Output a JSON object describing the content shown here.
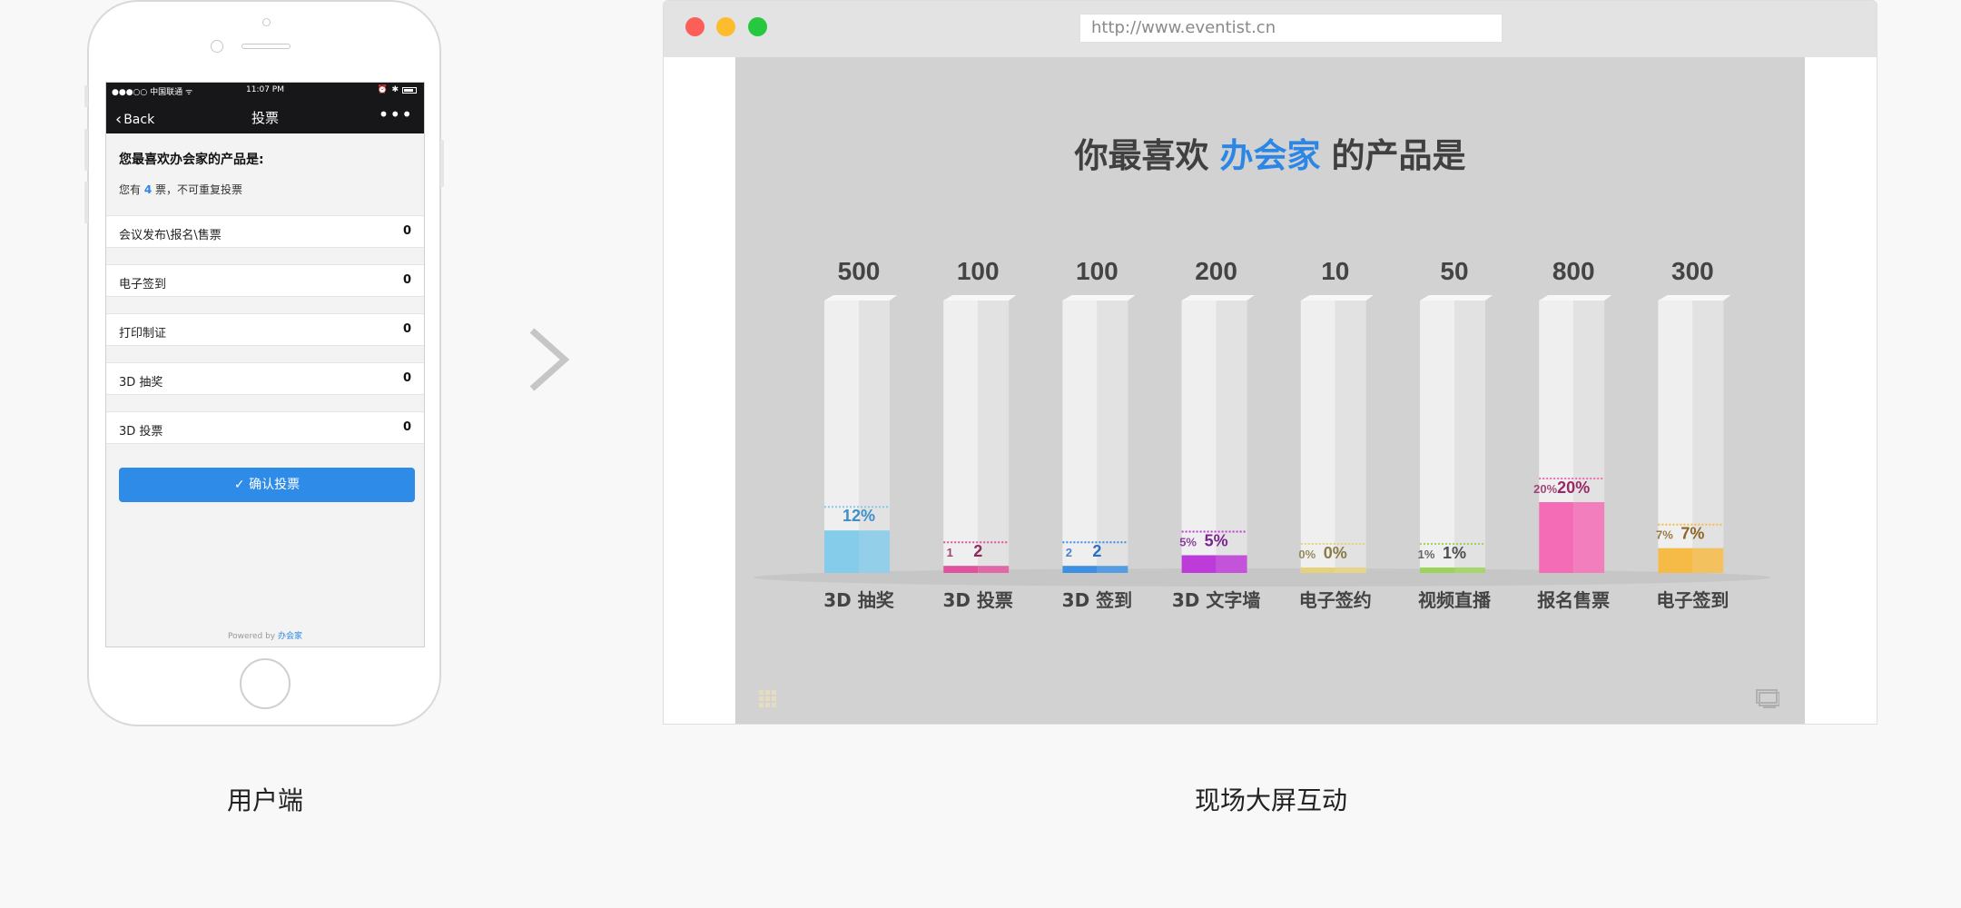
{
  "phone": {
    "status": {
      "carrier": "●●●○○ 中国联通 ᯤ",
      "time": "11:07 PM"
    },
    "nav": {
      "back": "Back",
      "title": "投票",
      "more": "•••"
    },
    "question": "您最喜欢办会家的产品是:",
    "note_prefix": "您有",
    "votes": "4",
    "note_suffix": "票，不可重复投票",
    "options": [
      {
        "label": "会议发布\\报名\\售票",
        "count": "0"
      },
      {
        "label": "电子签到",
        "count": "0"
      },
      {
        "label": "打印制证",
        "count": "0"
      },
      {
        "label": "3D 抽奖",
        "count": "0"
      },
      {
        "label": "3D 投票",
        "count": "0"
      }
    ],
    "confirm": "✓ 确认投票",
    "powered_prefix": "Powered by ",
    "powered_brand": "办会家"
  },
  "captions": {
    "user": "用户端",
    "screen": "现场大屏互动"
  },
  "browser": {
    "url": "http://www.eventist.cn"
  },
  "screen_title": {
    "prefix": "你最喜欢",
    "brand": "办会家",
    "suffix": "的产品是"
  },
  "chart_data": {
    "type": "bar",
    "categories": [
      "3D 抽奖",
      "3D 投票",
      "3D 签到",
      "3D 文字墙",
      "电子签约",
      "视频直播",
      "报名售票",
      "电子签到"
    ],
    "top_values": [
      "500",
      "100",
      "100",
      "200",
      "10",
      "50",
      "800",
      "300"
    ],
    "values": [
      12,
      2,
      2,
      5,
      0,
      1,
      20,
      7
    ],
    "value_labels": [
      "12%",
      "2",
      "2",
      "5%",
      "0%",
      "1%",
      "20%",
      "7%"
    ],
    "side_labels": [
      "",
      "1",
      "2",
      "5%",
      "0%",
      "1%",
      "20%",
      "7%"
    ],
    "colors": [
      "#85cbea",
      "#e0529c",
      "#3d8fe2",
      "#bd3bd8",
      "#e6d27a",
      "#9cd35a",
      "#f56cb6",
      "#f6bb46"
    ],
    "label_colors": [
      "#3d8fc6",
      "#8d2a5a",
      "#2b6fc2",
      "#7b2490",
      "#8a7a45",
      "#4e4e4e",
      "#9a2a66",
      "#8c6626"
    ],
    "ylim": [
      0,
      100
    ]
  }
}
